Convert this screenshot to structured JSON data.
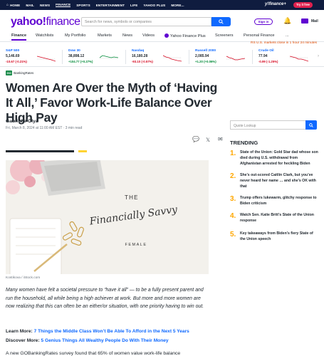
{
  "topnav": {
    "items": [
      "HOME",
      "MAIL",
      "NEWS",
      "FINANCE",
      "SPORTS",
      "ENTERTAINMENT",
      "LIFE",
      "YAHOO PLUS",
      "MORE..."
    ],
    "brand": "y!finance+",
    "cta": "Try it free"
  },
  "header": {
    "logo_yahoo": "yahoo!",
    "logo_finance": "finance",
    "search_placeholder": "Search for news, symbols or companies",
    "signin": "Sign in",
    "mail": "Mail"
  },
  "subnav": {
    "items": [
      "Finance",
      "Watchlists",
      "My Portfolio",
      "Markets",
      "News",
      "Videos",
      "Yahoo Finance Plus",
      "Screeners",
      "Personal Finance",
      "..."
    ]
  },
  "market_note": "RS U.S. markets close in 1 hour 24 minutes",
  "tickers": [
    {
      "name": "S&P 500",
      "price": "5,146.69",
      "change": "-10.67 (-0.21%)",
      "direction": "down"
    },
    {
      "name": "Dow 30",
      "price": "38,898.12",
      "change": "+104.77 (+0.27%)",
      "direction": "up"
    },
    {
      "name": "Nasdaq",
      "price": "16,180.28",
      "change": "-93.10 (-0.57%)",
      "direction": "down"
    },
    {
      "name": "Russell 2000",
      "price": "2,085.94",
      "change": "+1.20 (+0.06%)",
      "direction": "up"
    },
    {
      "name": "Crude Oil",
      "price": "77.94",
      "change": "-0.99 (-1.25%)",
      "direction": "down"
    }
  ],
  "article": {
    "source_badge": "GO",
    "source_name": "BankingRates",
    "headline": "Women Are Over the Myth of ‘Having It All,’ Favor Work-Life Balance Over High Pay",
    "author": "Gabrielle Olya",
    "byline": "Fri, March 8, 2024 at 11:00 AM EST · 3 min read",
    "image_text_the": "THE",
    "image_text_main": "Financially Savvy",
    "image_text_sub": "FEMALE",
    "photo_credit": "Kostikova / iStock.com",
    "paragraph": "Many women have felt a societal pressure to “have it all” — to be a fully present parent and run the household, all while being a high achiever at work. But more and more women are now realizing that this can often be an either/or situation, with one priority having to win out.",
    "learn_label": "Learn More:",
    "learn_link": "7 Things the Middle Class Won’t Be Able To Afford in the Next 5 Years",
    "discover_label": "Discover More:",
    "discover_link": "5 Genius Things All Wealthy People Do With Their Money",
    "paragraph2": "A new GOBankingRates survey found that 65% of women value work-life balance"
  },
  "sidebar": {
    "quote_placeholder": "Quote Lookup",
    "trending_title": "TRENDING",
    "trending": [
      "State of the Union: Gold Star dad whose son died during U.S. withdrawal from Afghanistan arrested for heckling Biden",
      "She’s out-scored Caitlin Clark, but you’ve never heard her name … and she’s OK with that",
      "Trump offers lukewarm, glitchy response to Biden criticism",
      "Watch Sen. Katie Britt’s State of the Union response",
      "Key takeaways from Biden’s fiery State of the Union speech"
    ]
  },
  "colors": {
    "brand_purple": "#5f01d1",
    "link_blue": "#0f69ff",
    "up_green": "#008a38",
    "down_red": "#d60a22",
    "trending_orange": "#ffa700"
  }
}
